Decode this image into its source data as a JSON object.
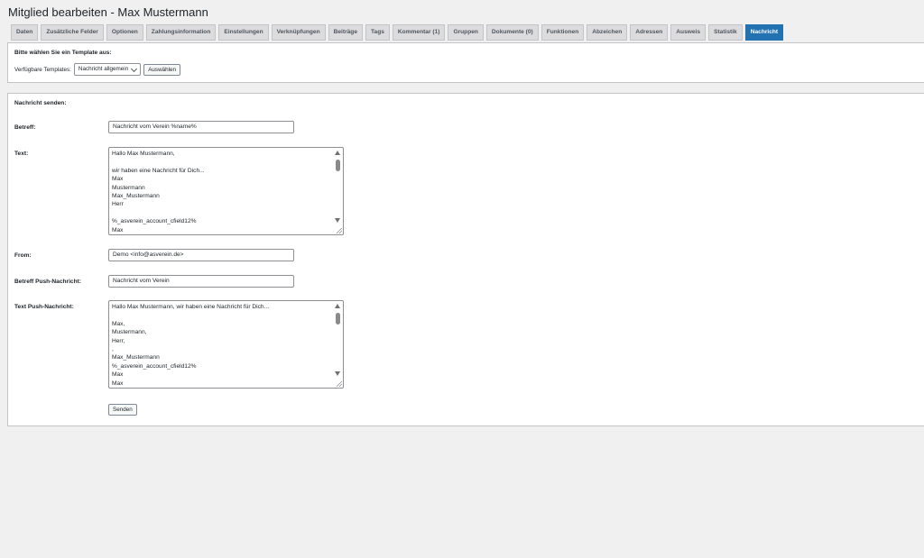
{
  "page": {
    "title": "Mitglied bearbeiten - Max Mustermann"
  },
  "tabs": [
    {
      "label": "Daten",
      "active": false
    },
    {
      "label": "Zusätzliche Felder",
      "active": false
    },
    {
      "label": "Optionen",
      "active": false
    },
    {
      "label": "Zahlungsinformation",
      "active": false
    },
    {
      "label": "Einstellungen",
      "active": false
    },
    {
      "label": "Verknüpfungen",
      "active": false
    },
    {
      "label": "Beiträge",
      "active": false
    },
    {
      "label": "Tags",
      "active": false
    },
    {
      "label": "Kommentar (1)",
      "active": false
    },
    {
      "label": "Gruppen",
      "active": false
    },
    {
      "label": "Dokumente (0)",
      "active": false
    },
    {
      "label": "Funktionen",
      "active": false
    },
    {
      "label": "Abzeichen",
      "active": false
    },
    {
      "label": "Adressen",
      "active": false
    },
    {
      "label": "Ausweis",
      "active": false
    },
    {
      "label": "Statistik",
      "active": false
    },
    {
      "label": "Nachricht",
      "active": true
    }
  ],
  "template_panel": {
    "heading": "Bitte wählen Sie ein Template aus:",
    "label": "Verfügbare Templates:",
    "selected": "Nachricht allgemein",
    "button": "Auswählen"
  },
  "message_panel": {
    "heading": "Nachricht senden:",
    "subject_label": "Betreff:",
    "subject_value": "Nachricht vom Verein %name%",
    "text_label": "Text:",
    "text_lines": [
      "Hallo Max Mustermann,",
      "",
      "wir haben eine Nachricht für Dich...",
      "Max",
      "Mustermann",
      "Max_Mustermann",
      "Herr",
      "",
      "%_asverein_account_cfield12%",
      "Max"
    ],
    "from_label": "From:",
    "from_value": "Demo <info@asverein.de>",
    "push_subject_label": "Betreff Push-Nachricht:",
    "push_subject_value": "Nachricht vom Verein",
    "push_text_label": "Text Push-Nachricht:",
    "push_text_lines": [
      "Hallo Max Mustermann, wir haben eine Nachricht für Dich...",
      "",
      "Max,",
      "Mustermann,",
      "Herr,",
      ",",
      "Max_Mustermann",
      "%_asverein_account_cfield12%",
      "Max",
      "Max"
    ],
    "send_button": "Senden"
  },
  "colors": {
    "accent": "#2271b1",
    "background": "#f0f0f1"
  }
}
